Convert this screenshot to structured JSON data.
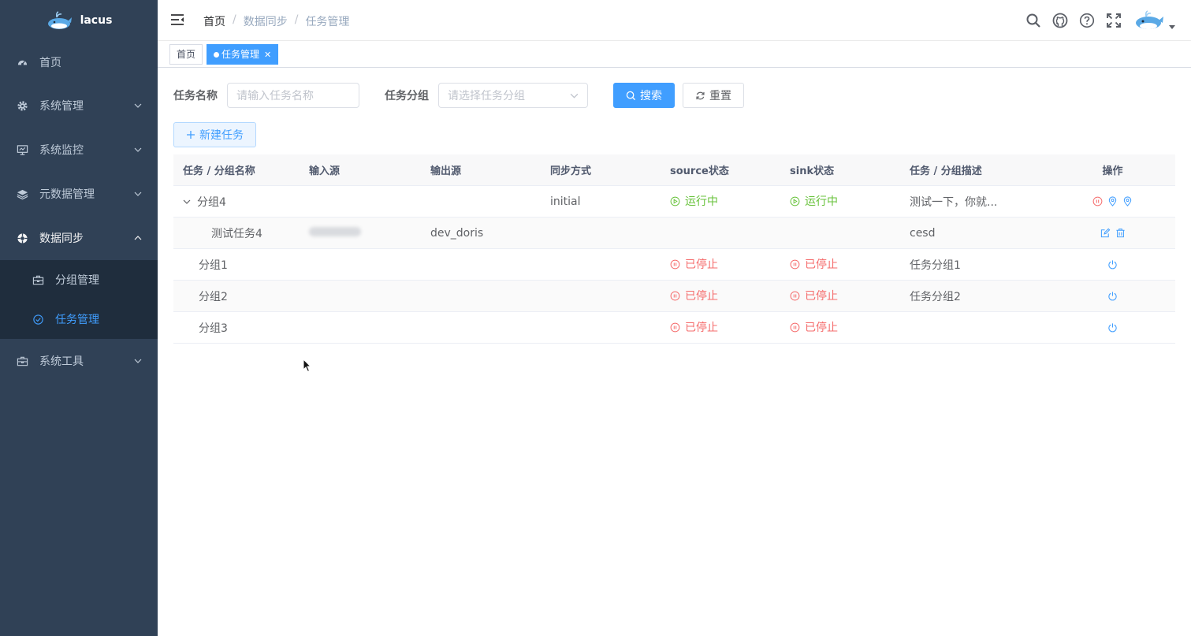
{
  "app": {
    "name": "lacus"
  },
  "sidebar": {
    "items": [
      {
        "label": "首页",
        "icon": "dashboard-icon"
      },
      {
        "label": "系统管理",
        "icon": "gear-icon"
      },
      {
        "label": "系统监控",
        "icon": "monitor-icon"
      },
      {
        "label": "元数据管理",
        "icon": "layers-icon"
      },
      {
        "label": "数据同步",
        "icon": "sync-icon"
      },
      {
        "label": "系统工具",
        "icon": "toolbox-icon"
      }
    ],
    "sub": [
      {
        "label": "分组管理",
        "icon": "briefcase-icon"
      },
      {
        "label": "任务管理",
        "icon": "circle-check-icon"
      }
    ]
  },
  "breadcrumb": {
    "home": "首页",
    "parent": "数据同步",
    "current": "任务管理"
  },
  "tags": {
    "home": "首页",
    "current": "任务管理"
  },
  "filters": {
    "task_name_label": "任务名称",
    "task_name_placeholder": "请输入任务名称",
    "task_group_label": "任务分组",
    "task_group_placeholder": "请选择任务分组",
    "search_label": "搜索",
    "reset_label": "重置",
    "new_task_label": "新建任务"
  },
  "table": {
    "headers": [
      "任务 / 分组名称",
      "输入源",
      "输出源",
      "同步方式",
      "source状态",
      "sink状态",
      "任务 / 分组描述",
      "操作"
    ],
    "rows": [
      {
        "name": "分组4",
        "input": "",
        "output": "",
        "sync": "initial",
        "source": "运行中",
        "sink": "运行中",
        "desc": "测试一下，你就..."
      },
      {
        "name": "测试任务4",
        "input": "",
        "output": "dev_doris",
        "sync": "",
        "source": "",
        "sink": "",
        "desc": "cesd"
      },
      {
        "name": "分组1",
        "input": "",
        "output": "",
        "sync": "",
        "source": "已停止",
        "sink": "已停止",
        "desc": "任务分组1"
      },
      {
        "name": "分组2",
        "input": "",
        "output": "",
        "sync": "",
        "source": "已停止",
        "sink": "已停止",
        "desc": "任务分组2"
      },
      {
        "name": "分组3",
        "input": "",
        "output": "",
        "sync": "",
        "source": "已停止",
        "sink": "已停止",
        "desc": ""
      }
    ]
  },
  "colors": {
    "sidebar_bg": "#304156",
    "submenu_bg": "#1f2d3d",
    "primary": "#409eff",
    "success": "#67c23a",
    "danger": "#f56c6c"
  }
}
